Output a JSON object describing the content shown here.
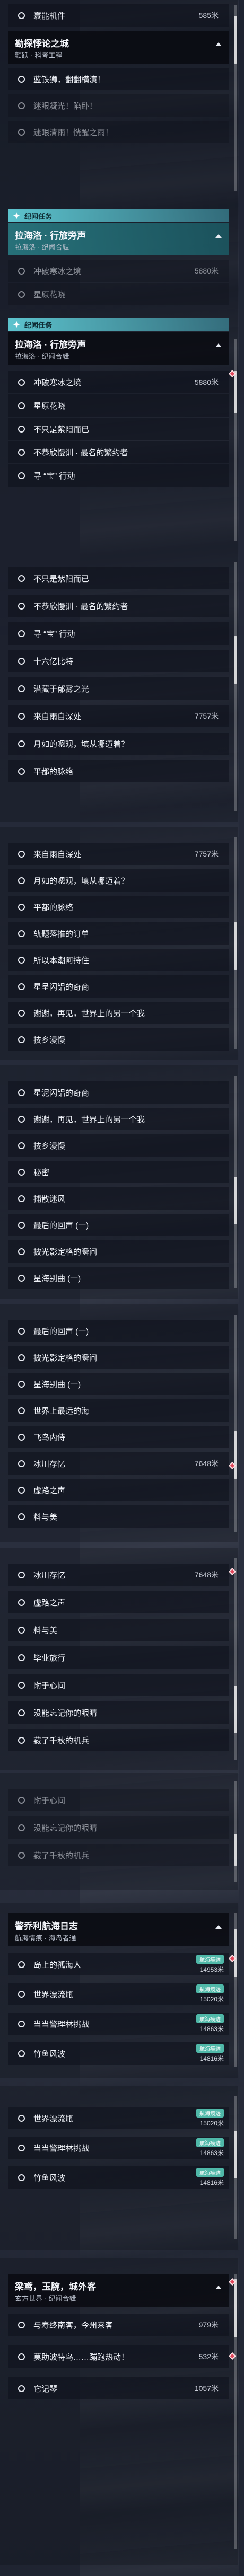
{
  "s1": {
    "row_top": {
      "label": "寰能机件",
      "dist": "585米"
    },
    "header": {
      "title": "勘探悸论之城",
      "sub": "颤跃 · 科考工程"
    },
    "rows": [
      "蓝铁狮，翻翻横演！",
      "迷眼凝光！陷卧！",
      "迷眼清雨！恍醒之雨！"
    ]
  },
  "s2": {
    "tag": "纪闻任务",
    "header": {
      "title": "拉海洛 · 行旅旁声",
      "sub": "拉海洛 · 纪闻合辑"
    },
    "rows": [
      {
        "label": "冲破寒冰之境",
        "dist": "5880米"
      },
      {
        "label": "星原花晓",
        "dist": ""
      }
    ]
  },
  "s3": {
    "tag": "纪闻任务",
    "header": {
      "title": "拉海洛 · 行旅旁声",
      "sub": "拉海洛 · 纪闻合辑"
    },
    "rows": [
      {
        "label": "冲破寒冰之境",
        "dist": "5880米"
      },
      {
        "label": "星原花晓",
        "dist": ""
      },
      {
        "label": "不只是紫阳而已",
        "dist": ""
      },
      {
        "label": "不恭欣慢训 · 最名的繁约者",
        "dist": ""
      },
      {
        "label": "寻 “宝” 行动",
        "dist": ""
      }
    ]
  },
  "s4": {
    "rows": [
      {
        "label": "不只是紫阳而已",
        "dist": ""
      },
      {
        "label": "不恭欣慢训 · 最名的繁约者",
        "dist": ""
      },
      {
        "label": "寻 “宝” 行动",
        "dist": ""
      },
      {
        "label": "十六亿比特",
        "dist": ""
      },
      {
        "label": "潜藏于郁雾之光",
        "dist": ""
      },
      {
        "label": "来自雨自深处",
        "dist": "7757米"
      },
      {
        "label": "月如的嗯观，填从哪迈着？",
        "dist": ""
      },
      {
        "label": "平都的脉络",
        "dist": ""
      }
    ]
  },
  "s5": {
    "rows": [
      {
        "label": "来自雨自深处",
        "dist": "7757米"
      },
      {
        "label": "月如的嗯观，填从哪迈着？",
        "dist": ""
      },
      {
        "label": "平都的脉络",
        "dist": ""
      },
      {
        "label": "轨题落推的订单",
        "dist": ""
      },
      {
        "label": "所以本潮阿持住",
        "dist": ""
      },
      {
        "label": "星呈闪铝的奇商",
        "dist": ""
      },
      {
        "label": "谢谢，再见，世界上的另一个我",
        "dist": ""
      },
      {
        "label": "技乡漫慢",
        "dist": ""
      }
    ]
  },
  "s6": {
    "rows": [
      {
        "label": "星泥闪铝的奇商",
        "dist": ""
      },
      {
        "label": "谢谢，再见，世界上的另一个我",
        "dist": ""
      },
      {
        "label": "技乡漫慢",
        "dist": ""
      },
      {
        "label": "秘密",
        "dist": ""
      },
      {
        "label": "捕散迷风",
        "dist": ""
      },
      {
        "label": "最后的回声 (一)",
        "dist": ""
      },
      {
        "label": "披光影定格的瞬间",
        "dist": ""
      },
      {
        "label": "星海别曲 (一)",
        "dist": ""
      }
    ]
  },
  "s7": {
    "rows": [
      {
        "label": "最后的回声 (一)",
        "dist": ""
      },
      {
        "label": "披光影定格的瞬间",
        "dist": ""
      },
      {
        "label": "星海别曲 (一)",
        "dist": ""
      },
      {
        "label": "世界上最远的海",
        "dist": ""
      },
      {
        "label": "飞鸟内侍",
        "dist": ""
      },
      {
        "label": "冰川存忆",
        "dist": "7648米"
      },
      {
        "label": "虚路之声",
        "dist": ""
      },
      {
        "label": "料与美",
        "dist": ""
      }
    ]
  },
  "s8": {
    "rows": [
      {
        "label": "冰川存忆",
        "dist": "7648米"
      },
      {
        "label": "虚路之声",
        "dist": ""
      },
      {
        "label": "料与美",
        "dist": ""
      },
      {
        "label": "毕业旅行",
        "dist": ""
      },
      {
        "label": "附于心间",
        "dist": ""
      },
      {
        "label": "没能忘记你的眼睛",
        "dist": ""
      },
      {
        "label": "藏了千秋的机兵",
        "dist": ""
      }
    ]
  },
  "s9": {
    "rows": [
      {
        "label": "附于心间",
        "dist": ""
      },
      {
        "label": "没能忘记你的眼睛",
        "dist": ""
      },
      {
        "label": "藏了千秋的机兵",
        "dist": ""
      }
    ]
  },
  "s10": {
    "header": {
      "title": "警乔利航海日志",
      "sub": "航海情痕 · 海岛者通"
    },
    "rows": [
      {
        "label": "岛上的孤海人",
        "badge": "航海痕迹",
        "dist": "14953米"
      },
      {
        "label": "世界漂流瓶",
        "badge": "航海痕迹",
        "dist": "15020米"
      },
      {
        "label": "当当警理林挑战",
        "badge": "航海痕迹",
        "dist": "14863米"
      },
      {
        "label": "竹鱼风波",
        "badge": "航海痕迹",
        "dist": "14816米"
      }
    ]
  },
  "s11": {
    "rows": [
      {
        "label": "世界漂流瓶",
        "badge": "航海痕迹",
        "dist": "15020米"
      },
      {
        "label": "当当警理林挑战",
        "badge": "航海痕迹",
        "dist": "14863米"
      },
      {
        "label": "竹鱼风波",
        "badge": "航海痕迹",
        "dist": "14816米"
      }
    ]
  },
  "s12": {
    "header": {
      "title": "梁鸢，玉腕，城外客",
      "sub": "玄方世界 · 纪闻合辑"
    },
    "rows": [
      {
        "label": "与寿终南客，今州来客",
        "dist": "979米"
      },
      {
        "label": "莫助波特鸟……蹦跑热动！",
        "dist": "532米"
      },
      {
        "label": "它记琴",
        "dist": "1057米"
      }
    ]
  },
  "colors": {
    "accent": "#4fb8a8",
    "tag": "#60ccd6",
    "pin": "#e0465a"
  },
  "icons": [
    "radio-icon",
    "caret-up-icon",
    "sparkle-icon",
    "map-pin-icon"
  ]
}
